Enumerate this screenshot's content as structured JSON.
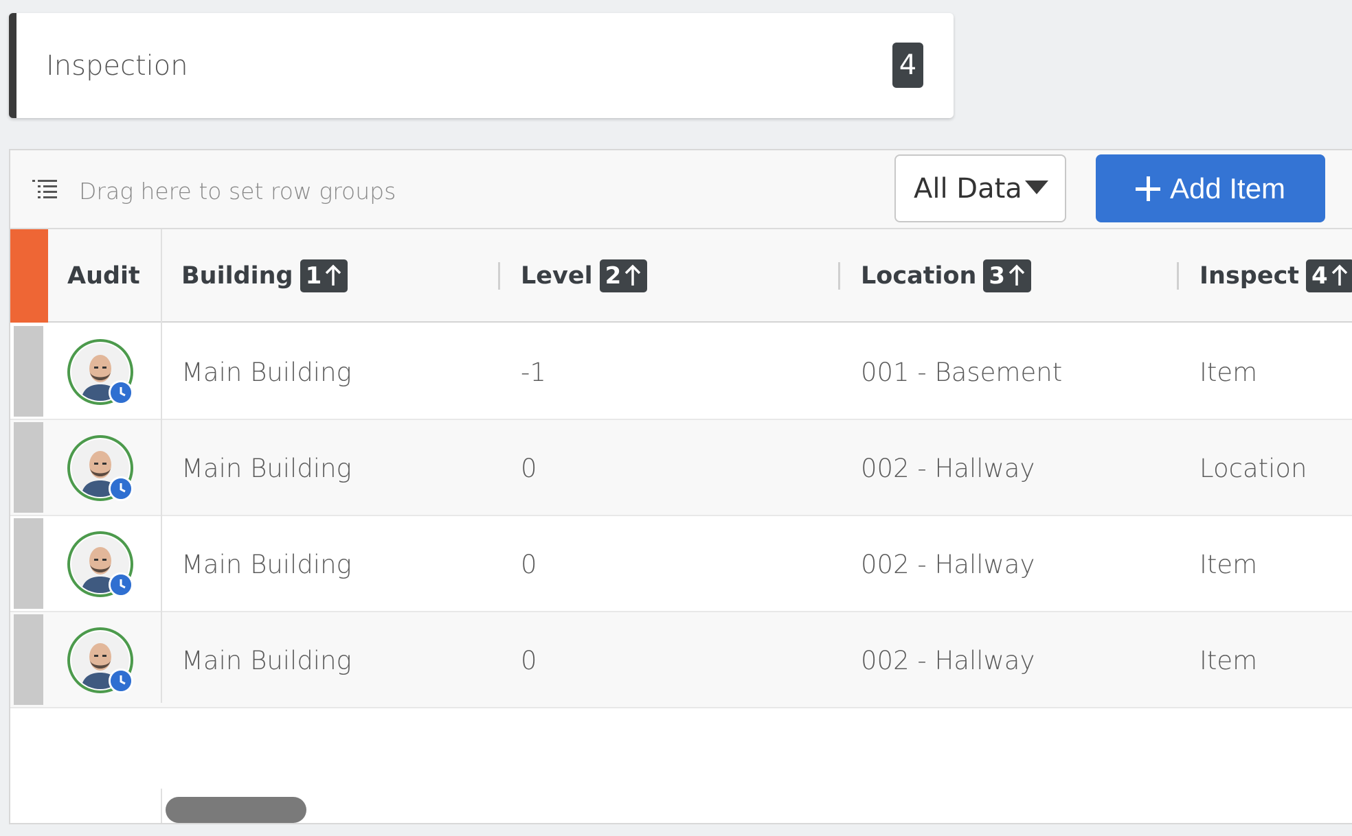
{
  "header": {
    "title": "Inspection",
    "count": "4"
  },
  "toolbar": {
    "row_group_hint": "Drag here to set row groups",
    "data_select": "All Data",
    "add_label": "Add Item"
  },
  "columns": {
    "audit": "Audit",
    "building": {
      "label": "Building",
      "sort": "1"
    },
    "level": {
      "label": "Level",
      "sort": "2"
    },
    "location": {
      "label": "Location",
      "sort": "3"
    },
    "inspect": {
      "label": "Inspect",
      "sort": "4"
    }
  },
  "rows": [
    {
      "building": "Main Building",
      "level": "-1",
      "location": "001 - Basement",
      "inspect": "Item"
    },
    {
      "building": "Main Building",
      "level": "0",
      "location": "002 - Hallway",
      "inspect": "Location"
    },
    {
      "building": "Main Building",
      "level": "0",
      "location": "002 - Hallway",
      "inspect": "Item"
    },
    {
      "building": "Main Building",
      "level": "0",
      "location": "002 - Hallway",
      "inspect": "Item"
    }
  ],
  "colors": {
    "accent": "#3474d4",
    "status": "#ee6635",
    "avatar_ring": "#4c9a4c",
    "badge": "#3f4448"
  },
  "icons": {
    "row_group": "row-group-icon",
    "dropdown": "caret-down-icon",
    "add": "plus-icon",
    "sort": "arrow-up-icon",
    "pending": "clock-icon"
  }
}
